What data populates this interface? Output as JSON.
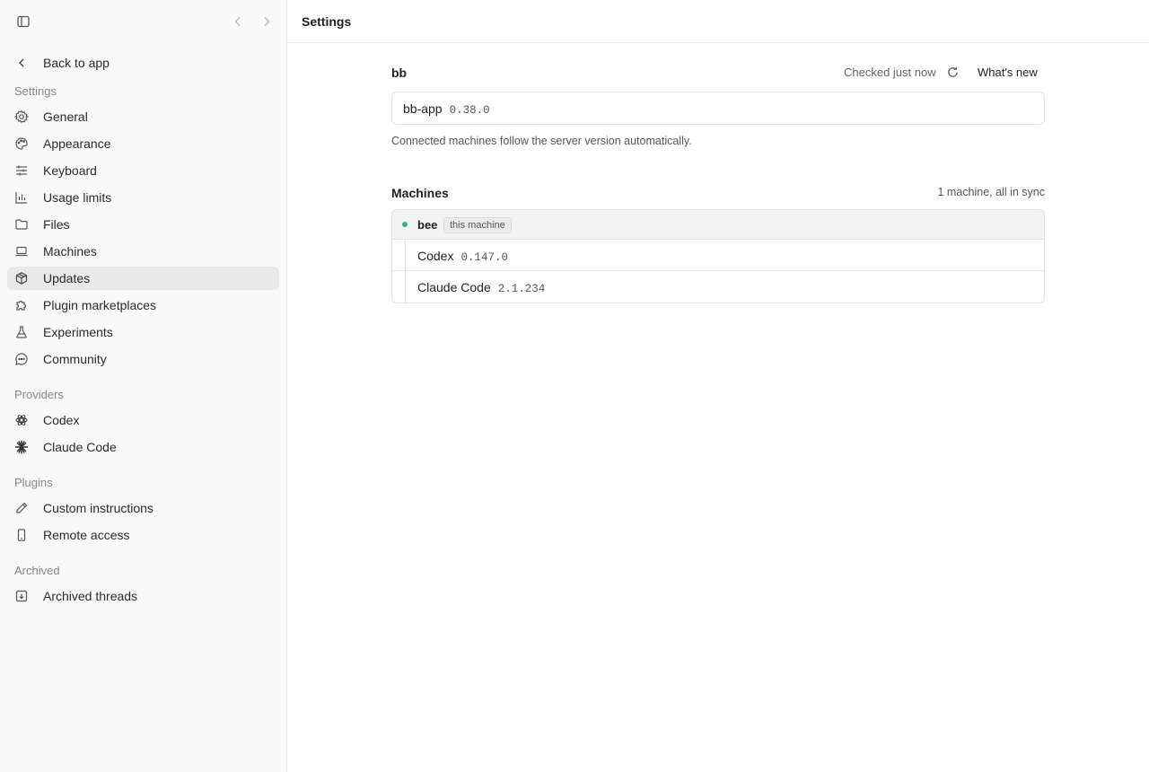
{
  "sidebar": {
    "back_label": "Back to app",
    "sections": {
      "settings": "Settings",
      "providers": "Providers",
      "plugins": "Plugins",
      "archived": "Archived"
    },
    "items": {
      "general": "General",
      "appearance": "Appearance",
      "keyboard": "Keyboard",
      "usage_limits": "Usage limits",
      "files": "Files",
      "machines": "Machines",
      "updates": "Updates",
      "plugin_marketplaces": "Plugin marketplaces",
      "experiments": "Experiments",
      "community": "Community",
      "codex": "Codex",
      "claude_code": "Claude Code",
      "custom_instructions": "Custom instructions",
      "remote_access": "Remote access",
      "archived_threads": "Archived threads"
    },
    "active_item": "updates"
  },
  "header": {
    "title": "Settings"
  },
  "app_section": {
    "title": "bb",
    "status": "Checked just now",
    "whats_new_label": "What's new",
    "package_name": "bb-app",
    "package_version": "0.38.0",
    "note": "Connected machines follow the server version automatically."
  },
  "machines_section": {
    "title": "Machines",
    "summary": "1 machine, all in sync",
    "machine": {
      "name": "bee",
      "badge": "this machine",
      "status_color": "#3cb371",
      "tools": [
        {
          "name": "Codex",
          "version": "0.147.0"
        },
        {
          "name": "Claude Code",
          "version": "2.1.234"
        }
      ]
    }
  }
}
